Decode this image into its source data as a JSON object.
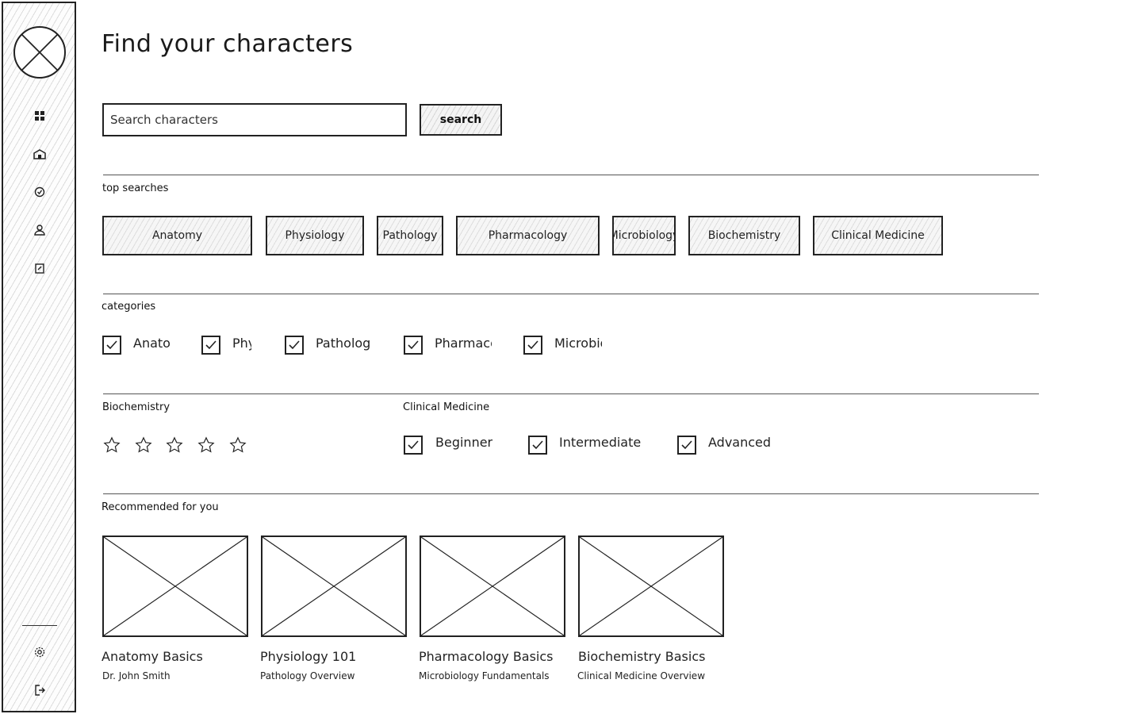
{
  "sidebar": {
    "nav": [
      {
        "name": "dashboard-icon",
        "icon": "grid"
      },
      {
        "name": "school-icon",
        "icon": "building"
      },
      {
        "name": "verified-icon",
        "icon": "check-badge"
      },
      {
        "name": "user-icon",
        "icon": "person"
      },
      {
        "name": "assignment-icon",
        "icon": "clipboard"
      }
    ],
    "bottom": [
      {
        "name": "settings-icon",
        "icon": "gear"
      },
      {
        "name": "logout-icon",
        "icon": "exit"
      }
    ]
  },
  "header": {
    "title": "Find your characters"
  },
  "search": {
    "placeholder": "Search characters",
    "value": "",
    "button_label": "search"
  },
  "top_searches": {
    "label": "top searches",
    "items": [
      "Anatomy",
      "Physiology",
      "Pathology",
      "Pharmacology",
      "Microbiology",
      "Biochemistry",
      "Clinical Medicine"
    ]
  },
  "categories": {
    "label": "categories",
    "items": [
      {
        "label": "Anatomy",
        "checked": true
      },
      {
        "label": "Physiology",
        "checked": true
      },
      {
        "label": "Pathology",
        "checked": true
      },
      {
        "label": "Pharmacology",
        "checked": true
      },
      {
        "label": "Microbiology",
        "checked": true
      }
    ]
  },
  "rating": {
    "label": "Biochemistry",
    "stars": 5,
    "value": 0
  },
  "level": {
    "label": "Clinical Medicine",
    "items": [
      {
        "label": "Beginner",
        "checked": true
      },
      {
        "label": "Intermediate",
        "checked": true
      },
      {
        "label": "Advanced",
        "checked": true
      }
    ]
  },
  "recommended": {
    "label": "Recommended for you",
    "cards": [
      {
        "title": "Anatomy Basics",
        "subtitle": "Dr. John Smith"
      },
      {
        "title": "Physiology 101",
        "subtitle": "Pathology Overview"
      },
      {
        "title": "Pharmacology Basics",
        "subtitle": "Microbiology Fundamentals"
      },
      {
        "title": "Biochemistry Basics",
        "subtitle": "Clinical Medicine Overview"
      }
    ]
  },
  "colors": {
    "ink": "#222222",
    "background": "#ffffff",
    "hatch": "#dddddd"
  }
}
